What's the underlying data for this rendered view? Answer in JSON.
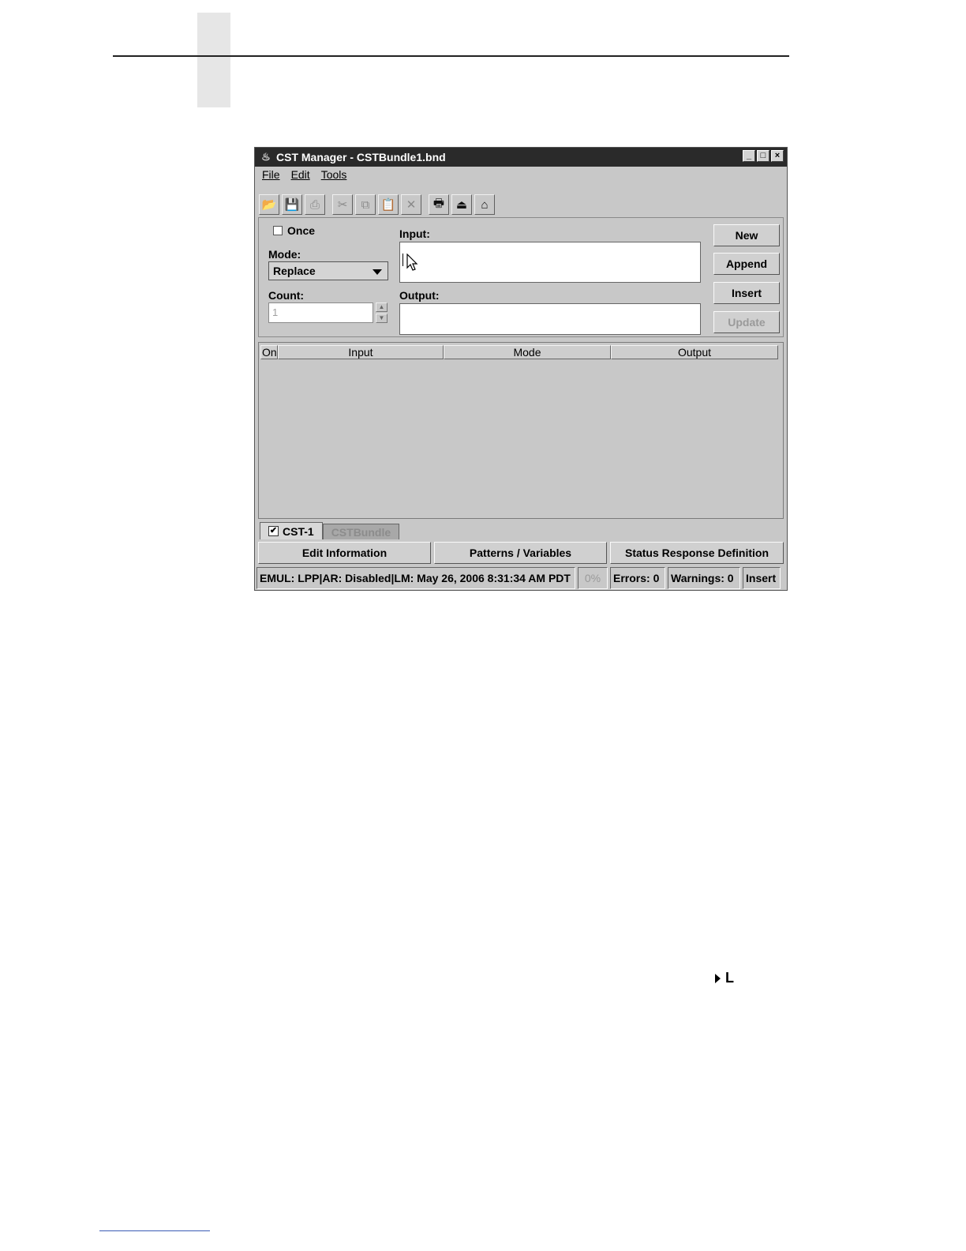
{
  "window": {
    "title": "CST Manager - CSTBundle1.bnd",
    "controls": {
      "minimize": "_",
      "maximize": "□",
      "close": "×"
    }
  },
  "menu": {
    "file": "File",
    "edit": "Edit",
    "tools": "Tools"
  },
  "toolbar": {
    "icons": [
      "open-icon",
      "save-icon",
      "print-icon",
      "cut-icon",
      "copy-icon",
      "paste-icon",
      "delete-icon",
      "download-icon",
      "upload-icon",
      "load-icon"
    ],
    "disabled": [
      "print-icon",
      "cut-icon",
      "copy-icon",
      "delete-icon"
    ]
  },
  "form": {
    "once_label": "Once",
    "once_checked": false,
    "mode_label": "Mode:",
    "mode_value": "Replace",
    "count_label": "Count:",
    "count_value": "1",
    "input_label": "Input:",
    "output_label": "Output:"
  },
  "actions": {
    "new": "New",
    "append": "Append",
    "insert": "Insert",
    "update": "Update"
  },
  "table": {
    "columns": [
      "On",
      "Input",
      "Mode",
      "Output"
    ],
    "rows": []
  },
  "tabs": [
    {
      "label": "CST-1",
      "checked": true,
      "active": true
    },
    {
      "label": "CSTBundle",
      "active": false
    }
  ],
  "bottom_buttons": {
    "edit_info": "Edit Information",
    "patterns": "Patterns / Variables",
    "status_response": "Status Response Definition"
  },
  "status": {
    "info": "EMUL: LPP|AR: Disabled|LM: May 26, 2006 8:31:34 AM PDT",
    "progress": "0%",
    "errors": "Errors: 0",
    "warnings": "Warnings: 0",
    "mode": "Insert"
  },
  "page": {
    "marker": "L"
  }
}
